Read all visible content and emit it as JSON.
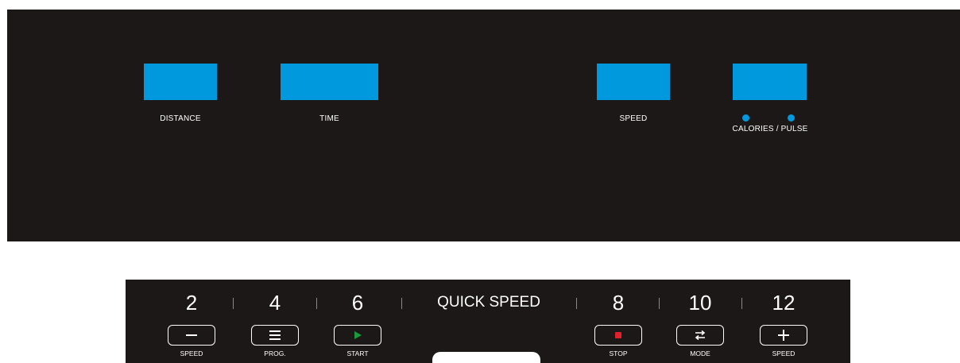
{
  "colors": {
    "panel": "#1c1818",
    "lcd": "#0099dd",
    "start_icon": "#1a9a3a",
    "stop_icon": "#e0202a"
  },
  "display": {
    "distance_label": "DISTANCE",
    "time_label": "TIME",
    "speed_label": "SPEED",
    "calories_pulse_label": "CALORIES / PULSE"
  },
  "quick_speed": {
    "title": "QUICK SPEED",
    "values": [
      "2",
      "4",
      "6",
      "8",
      "10",
      "12"
    ]
  },
  "keys": {
    "speed_down": {
      "icon": "minus-icon",
      "label": "SPEED"
    },
    "program": {
      "icon": "menu-icon",
      "label": "PROG."
    },
    "start": {
      "icon": "play-icon",
      "label": "START"
    },
    "stop": {
      "icon": "stop-icon",
      "label": "STOP"
    },
    "mode": {
      "icon": "swap-icon",
      "label": "MODE"
    },
    "speed_up": {
      "icon": "plus-icon",
      "label": "SPEED"
    }
  }
}
